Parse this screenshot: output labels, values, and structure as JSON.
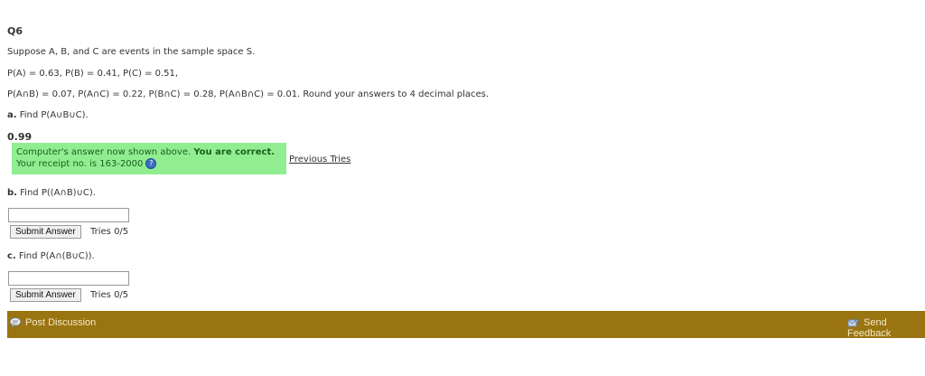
{
  "question": {
    "number": "Q6",
    "intro": "Suppose A, B, and C are events in the sample space S.",
    "line1": "P(A) = 0.63, P(B) = 0.41, P(C) = 0.51,",
    "line2": "P(A∩B) = 0.07, P(A∩C) = 0.22, P(B∩C) = 0.28, P(A∩B∩C) = 0.01. Round your answers to 4 decimal places."
  },
  "part_a": {
    "label": "a.",
    "prompt": "Find P(A∪B∪C).",
    "answer": "0.99",
    "feedback_text": "Computer's answer now shown above. ",
    "feedback_strong": "You are correct.",
    "receipt": "Your receipt no. is 163-2000",
    "help_icon_glyph": "?",
    "previous_tries": "Previous Tries"
  },
  "part_b": {
    "label": "b.",
    "prompt": "Find P((A∩B)∪C).",
    "input_value": "",
    "submit_label": "Submit Answer",
    "tries": "Tries 0/5"
  },
  "part_c": {
    "label": "c.",
    "prompt": "Find P(A∩(B∪C)).",
    "input_value": "",
    "submit_label": "Submit Answer",
    "tries": "Tries 0/5"
  },
  "footer": {
    "post_discussion": "Post Discussion",
    "send_feedback": "Send Feedback",
    "bar_color": "#9a7410",
    "correct_color": "#90ee90"
  }
}
